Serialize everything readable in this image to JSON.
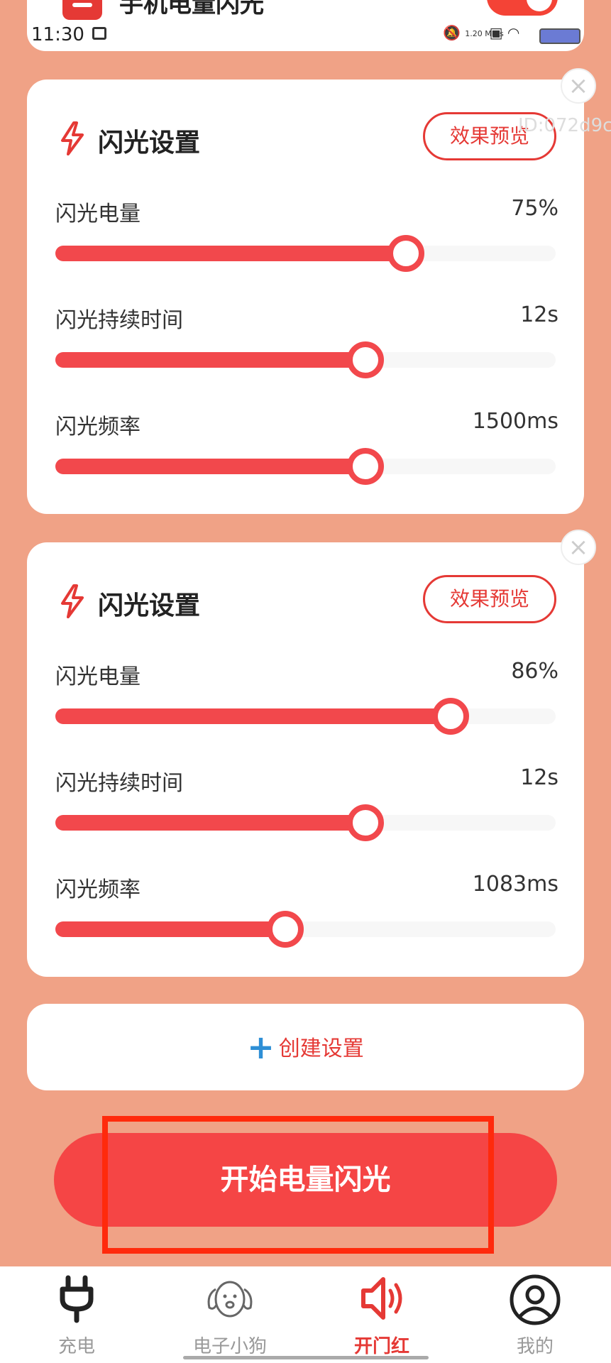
{
  "top_card": {
    "title": "手机电量闪光"
  },
  "status_bar": {
    "time": "11:30",
    "net_speed": "1.20 MB/s"
  },
  "watermark": "ID:072d9c",
  "cards": [
    {
      "title": "闪光设置",
      "preview_label": "效果预览",
      "sliders": [
        {
          "label": "闪光电量",
          "value": "75%",
          "fraction": 0.7
        },
        {
          "label": "闪光持续时间",
          "value": "12s",
          "fraction": 0.62
        },
        {
          "label": "闪光频率",
          "value": "1500ms",
          "fraction": 0.62
        }
      ]
    },
    {
      "title": "闪光设置",
      "preview_label": "效果预览",
      "sliders": [
        {
          "label": "闪光电量",
          "value": "86%",
          "fraction": 0.79
        },
        {
          "label": "闪光持续时间",
          "value": "12s",
          "fraction": 0.62
        },
        {
          "label": "闪光频率",
          "value": "1083ms",
          "fraction": 0.46
        }
      ]
    }
  ],
  "create_label": "创建设置",
  "start_button": "开始电量闪光",
  "nav": [
    {
      "label": "充电",
      "icon": "plug-icon"
    },
    {
      "label": "电子小狗",
      "icon": "dog-icon"
    },
    {
      "label": "开门红",
      "icon": "speaker-icon",
      "active": true
    },
    {
      "label": "我的",
      "icon": "user-icon"
    }
  ],
  "colors": {
    "accent": "#F2484C",
    "background": "#F0A286",
    "plus": "#2E8FD6"
  }
}
